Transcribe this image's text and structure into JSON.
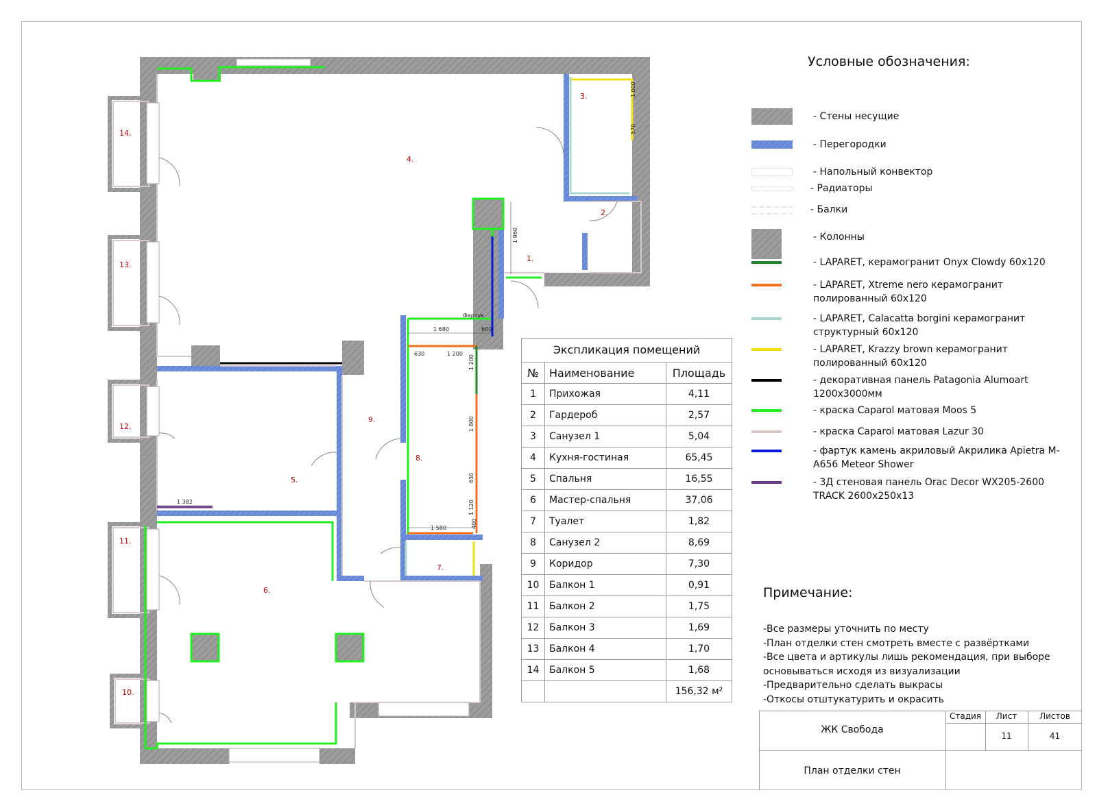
{
  "legend": {
    "title": "Условные обозначения:",
    "items": [
      {
        "label": "- Стены несущие",
        "swatch": "hatch-wall"
      },
      {
        "label": "- Перегородки",
        "swatch": "hatch-blue",
        "color": "#5b7fd4"
      },
      {
        "label": "- Напольный конвектор",
        "swatch": "dashed-box"
      },
      {
        "label": "- Радиаторы",
        "swatch": "dashed-thin"
      },
      {
        "label": "- Балки",
        "swatch": "dashed-long"
      },
      {
        "label": "- Колонны",
        "swatch": "hatch-column"
      },
      {
        "label": "- LAPARET, керамогранит Onyx Clowdy 60x120",
        "swatch": "line",
        "color": "#1a8a2a"
      },
      {
        "label": "- LAPARET, Xtreme nero керамогранит полированный 60x120",
        "swatch": "line",
        "color": "#f07020"
      },
      {
        "label": "- LAPARET, Calacatta borgini керамогранит структурный 60x120",
        "swatch": "line",
        "color": "#a8d8d0"
      },
      {
        "label": "- LAPARET, Krazzy brown керамогранит полированный 60x120",
        "swatch": "line",
        "color": "#f0e010"
      },
      {
        "label": "- декоративная панель Patagonia Alumoart 1200x3000мм",
        "swatch": "line",
        "color": "#000000"
      },
      {
        "label": "- краска Caparol матовая Moos 5",
        "swatch": "line",
        "color": "#22ee22"
      },
      {
        "label": "- краска Caparol матовая Lazur 30",
        "swatch": "line",
        "color": "#d8c8c8"
      },
      {
        "label": "- фартук камень акриловый Акрилика Apietra M-A656 Meteor Shower",
        "swatch": "line",
        "color": "#0a18d8"
      },
      {
        "label": "- 3Д стеновая панель Orac Decor WX205-2600 TRACK 2600x250x13",
        "swatch": "line",
        "color": "#6a3a8a"
      }
    ]
  },
  "explication": {
    "title": "Экспликация помещений",
    "headers": [
      "№",
      "Наименование",
      "Площадь"
    ],
    "rows": [
      [
        "1",
        "Прихожая",
        "4,11"
      ],
      [
        "2",
        "Гардероб",
        "2,57"
      ],
      [
        "3",
        "Санузел 1",
        "5,04"
      ],
      [
        "4",
        "Кухня-гостиная",
        "65,45"
      ],
      [
        "5",
        "Спальня",
        "16,55"
      ],
      [
        "6",
        "Мастер-спальня",
        "37,06"
      ],
      [
        "7",
        "Туалет",
        "1,82"
      ],
      [
        "8",
        "Санузел 2",
        "8,69"
      ],
      [
        "9",
        "Коридор",
        "7,30"
      ],
      [
        "10",
        "Балкон 1",
        "0,91"
      ],
      [
        "11",
        "Балкон 2",
        "1,75"
      ],
      [
        "12",
        "Балкон 3",
        "1,69"
      ],
      [
        "13",
        "Балкон 4",
        "1,70"
      ],
      [
        "14",
        "Балкон 5",
        "1,68"
      ]
    ],
    "total": "156,32 м²"
  },
  "notes": {
    "title": "Примечание:",
    "lines": [
      "-Все размеры уточнить по месту",
      "-План отделки стен смотреть вместе с развёртками",
      "-Все цвета и артикулы лишь рекомендация, при выборе",
      "основываться исходя из визуализации",
      "-Предварительно сделать выкрасы",
      "-Откосы отштукатурить и окрасить"
    ]
  },
  "stamp": {
    "project": "ЖК Свобода",
    "sheet_title": "План отделки стен",
    "stage_label": "Стадия",
    "sheet_label": "Лист",
    "sheets_label": "Листов",
    "stage": "",
    "sheet": "11",
    "sheets": "41"
  },
  "plan": {
    "room_labels": [
      "1.",
      "2.",
      "3.",
      "4.",
      "5.",
      "6.",
      "7.",
      "8.",
      "9.",
      "10.",
      "11.",
      "12.",
      "13.",
      "14."
    ],
    "dimensions": [
      "1 000",
      "570",
      "1 960",
      "1 680",
      "600",
      "Фартук",
      "630",
      "1 200",
      "1 200",
      "1 800",
      "630",
      "1 120",
      "400",
      "1 580",
      "1 382"
    ]
  }
}
